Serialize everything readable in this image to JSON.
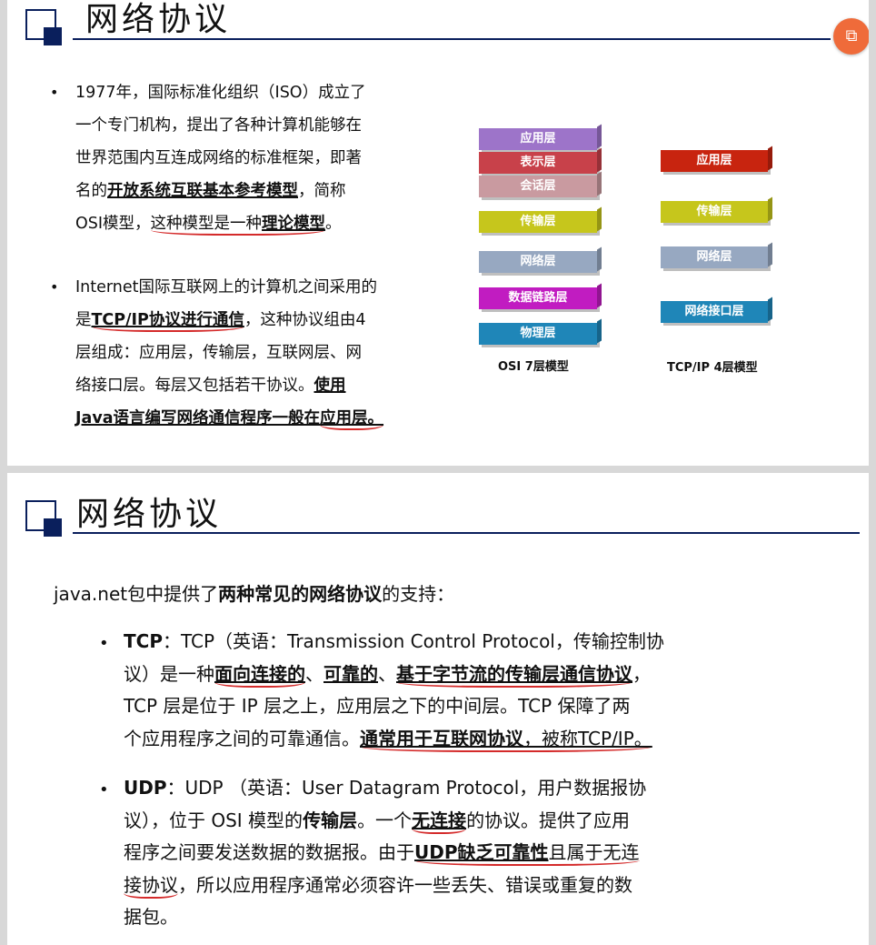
{
  "slide1": {
    "title": "网络协议",
    "nav_button_icon": "slideshow-icon",
    "bullet1": {
      "l1": "1977年，国际标准化组织（ISO）成立了",
      "l2": "一个专门机构，提出了各种计算机能够在",
      "l3": "世界范围内互连成网络的标准框架，即著",
      "l4_a": "名的",
      "l4_b": "开放系统互联基本参考模型",
      "l4_c": "，简称",
      "l5_a": "OSI模型，",
      "l5_b": "这种模型是一种",
      "l5_c": "理论模型",
      "l5_d": "。"
    },
    "bullet2": {
      "l1": "Internet国际互联网上的计算机之间采用的",
      "l2_a": "是",
      "l2_b": "TCP/IP协议进行通信",
      "l2_c": "，这种协议组由4",
      "l3": "层组成：应用层，传输层，互联网层、网",
      "l4_a": "络接口层。每层又包括若干协议。",
      "l4_b": "使用",
      "l5_a": "Java语言编写网络通信程序一般在",
      "l5_b": "应用层。"
    },
    "osi_layers": [
      "应用层",
      "表示层",
      "会话层",
      "传输层",
      "网络层",
      "数据链路层",
      "物理层"
    ],
    "osi_colors": [
      "#9d74c9",
      "#c8414a",
      "#c99aa0",
      "#c6c61c",
      "#97a8c1",
      "#c11cc1",
      "#1f86b8"
    ],
    "osi_label": "OSI 7层模型",
    "tcp_layers": [
      "应用层",
      "传输层",
      "网络层",
      "网络接口层"
    ],
    "tcp_colors": [
      "#c8240f",
      "#c6c61c",
      "#97a8c1",
      "#1f86b8"
    ],
    "tcp_label": "TCP/IP 4层模型"
  },
  "slide2": {
    "title": "网络协议",
    "intro_a": "java.net包中提供了",
    "intro_b": "两种常见的网络协议",
    "intro_c": "的支持：",
    "tcp": {
      "l1_a": "TCP",
      "l1_b": "：TCP（英语：Transmission Control Protocol，传输控制协",
      "l2_a": "议）是一种",
      "l2_b": "面向连接的",
      "l2_c": "、",
      "l2_d": "可靠的",
      "l2_e": "、",
      "l2_f": "基于字节流的传输层通信协议",
      "l2_g": "，",
      "l3": "TCP 层是位于 IP 层之上，应用层之下的中间层。TCP 保障了两",
      "l4_a": "个应用程序之间的可靠通信。",
      "l4_b": "通常用于互联网协议",
      "l4_c": "，被称TCP/IP。"
    },
    "udp": {
      "l1_a": "UDP",
      "l1_b": "：UDP （英语：User Datagram Protocol，用户数据报协",
      "l2_a": "议），位于 OSI 模型的",
      "l2_b": "传输层",
      "l2_c": "。一个",
      "l2_d": "无连接",
      "l2_e": "的协议。提供了应用",
      "l3_a": "程序之间要发送数据的数据报。由于",
      "l3_b": "UDP缺乏可靠性",
      "l3_c": "且属于无连",
      "l4_a": "接协议",
      "l4_b": "，所以应用程序通常必须容许一些丢失、错误或重复的数",
      "l5": "据包。"
    }
  }
}
